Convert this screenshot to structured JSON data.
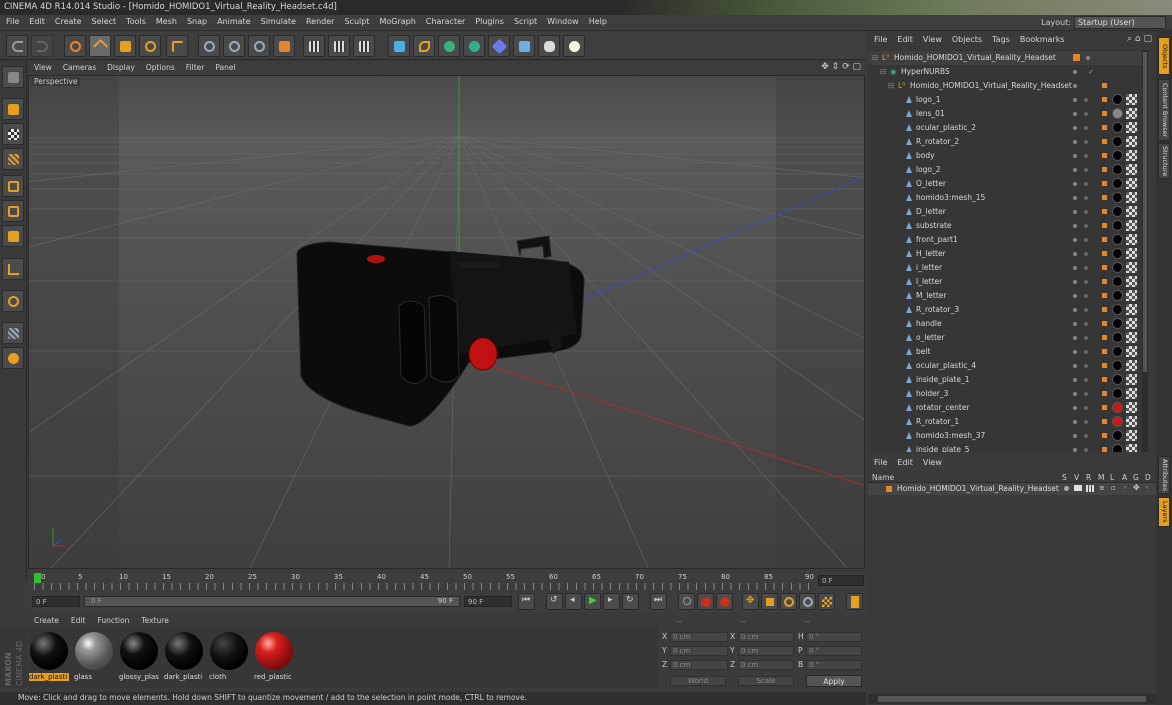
{
  "window": {
    "title": "CINEMA 4D R14.014 Studio - [Homido_HOMIDO1_Virtual_Reality_Headset.c4d]"
  },
  "menubar": {
    "items": [
      "File",
      "Edit",
      "Create",
      "Select",
      "Tools",
      "Mesh",
      "Snap",
      "Animate",
      "Simulate",
      "Render",
      "Sculpt",
      "MoGraph",
      "Character",
      "Plugins",
      "Script",
      "Window",
      "Help"
    ],
    "layout_label": "Layout:",
    "layout_value": "Startup (User)"
  },
  "viewport": {
    "menu": [
      "View",
      "Cameras",
      "Display",
      "Options",
      "Filter",
      "Panel"
    ],
    "label": "Perspective"
  },
  "timeline": {
    "ticks": [
      "0",
      "5",
      "10",
      "15",
      "20",
      "25",
      "30",
      "35",
      "40",
      "45",
      "50",
      "55",
      "60",
      "65",
      "70",
      "75",
      "80",
      "85",
      "90"
    ],
    "current_frame": "0 F"
  },
  "transport": {
    "start_field": "0 F",
    "slider_start": "0 F",
    "slider_end": "90 F",
    "end_field": "90 F"
  },
  "material_manager": {
    "menu": [
      "Create",
      "Edit",
      "Function",
      "Texture"
    ],
    "materials": [
      {
        "name": "dark_plasti",
        "color": "#000000",
        "selected": true
      },
      {
        "name": "glass",
        "color": "#888888",
        "selected": false
      },
      {
        "name": "glossy_plas",
        "color": "#000000",
        "selected": false
      },
      {
        "name": "dark_plasti",
        "color": "#000000",
        "selected": false
      },
      {
        "name": "cloth",
        "color": "#000000",
        "selected": false
      },
      {
        "name": "red_plastic",
        "color": "#c81818",
        "selected": false
      }
    ],
    "brand_top": "MAXON",
    "brand_bottom": "CINEMA 4D"
  },
  "coordinates": {
    "headers": [
      "--",
      "--",
      "--"
    ],
    "rows": [
      {
        "a": "X",
        "av": "0 cm",
        "b": "X",
        "bv": "0 cm",
        "c": "H",
        "cv": "0 °"
      },
      {
        "a": "Y",
        "av": "0 cm",
        "b": "Y",
        "bv": "0 cm",
        "c": "P",
        "cv": "0 °"
      },
      {
        "a": "Z",
        "av": "0 cm",
        "b": "Z",
        "bv": "0 cm",
        "c": "B",
        "cv": "0 °"
      }
    ],
    "mode1": "World",
    "mode2": "Scale",
    "apply": "Apply"
  },
  "statusbar": {
    "text": "Move: Click and drag to move elements. Hold down SHIFT to quantize movement / add to the selection in point mode, CTRL to remove."
  },
  "object_manager": {
    "menu": [
      "File",
      "Edit",
      "View",
      "Objects",
      "Tags",
      "Bookmarks"
    ],
    "root": "Homido_HOMIDO1_Virtual_Reality_Headset",
    "nurbs": "HyperNURBS",
    "group": "Homido_HOMIDO1_Virtual_Reality_Headset",
    "objects": [
      {
        "name": "logo_1",
        "tag": "#000000"
      },
      {
        "name": "lens_01",
        "tag": "#888888"
      },
      {
        "name": "ocular_plastic_2",
        "tag": "#000000"
      },
      {
        "name": "R_rotator_2",
        "tag": "#000000"
      },
      {
        "name": "body",
        "tag": "#000000"
      },
      {
        "name": "logo_2",
        "tag": "#000000"
      },
      {
        "name": "O_letter",
        "tag": "#000000"
      },
      {
        "name": "homido3:mesh_15",
        "tag": "#000000"
      },
      {
        "name": "D_letter",
        "tag": "#000000"
      },
      {
        "name": "substrate",
        "tag": "#000000"
      },
      {
        "name": "front_part1",
        "tag": "#000000"
      },
      {
        "name": "H_letter",
        "tag": "#000000"
      },
      {
        "name": "i_letter",
        "tag": "#000000"
      },
      {
        "name": "I_letter",
        "tag": "#000000"
      },
      {
        "name": "M_letter",
        "tag": "#000000"
      },
      {
        "name": "R_rotator_3",
        "tag": "#000000"
      },
      {
        "name": "handle",
        "tag": "#000000"
      },
      {
        "name": "o_letter",
        "tag": "#000000"
      },
      {
        "name": "belt",
        "tag": "#000000"
      },
      {
        "name": "ocular_plastic_4",
        "tag": "#000000"
      },
      {
        "name": "inside_plate_1",
        "tag": "#000000"
      },
      {
        "name": "holder_3",
        "tag": "#000000"
      },
      {
        "name": "rotator_center",
        "tag": "#c81818"
      },
      {
        "name": "R_rotator_1",
        "tag": "#c81818"
      },
      {
        "name": "homido3:mesh_37",
        "tag": "#000000"
      },
      {
        "name": "inside_plate_5",
        "tag": "#000000"
      }
    ]
  },
  "layer_manager": {
    "menu": [
      "File",
      "Edit",
      "View"
    ],
    "name_header": "Name",
    "col_headers": [
      "S",
      "V",
      "R",
      "M",
      "L",
      "A",
      "G",
      "D"
    ],
    "row": "Homido_HOMIDO1_Virtual_Reality_Headset"
  },
  "side_tabs": [
    "Objects",
    "Content Browser",
    "Structure",
    "Attributes",
    "Layers"
  ],
  "colors": {
    "accent_orange": "#e6842b",
    "x_axis": "#c0392b",
    "y_axis": "#3a9a3a",
    "z_axis": "#3a4ac0"
  }
}
